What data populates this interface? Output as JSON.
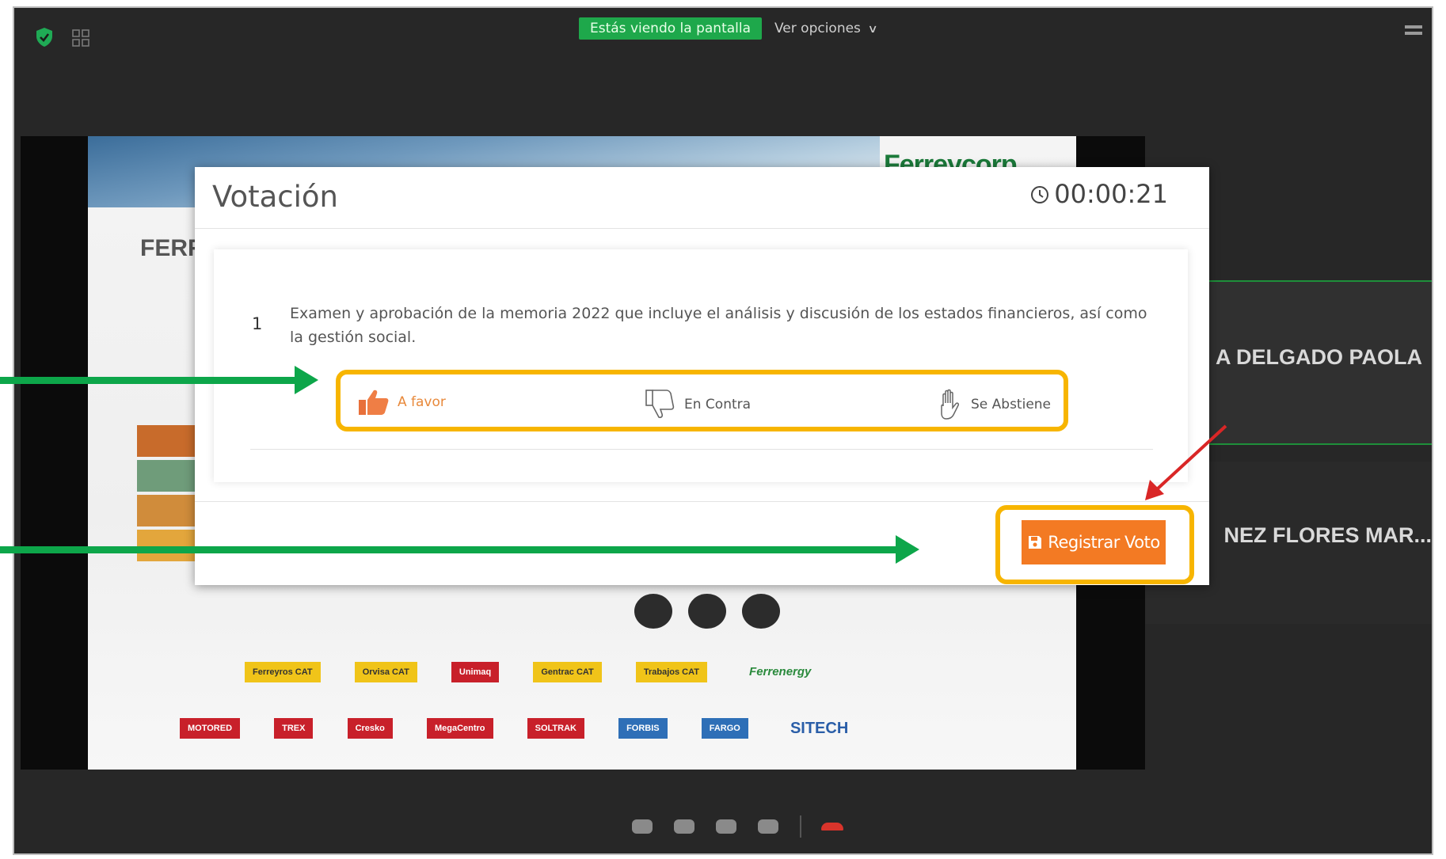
{
  "top_bar": {
    "screen_notice": "Estás viendo la pantalla",
    "view_options": "Ver opciones"
  },
  "slide": {
    "brand": "Ferreycorp",
    "title_fragment": "FERR",
    "logos_row1": [
      "Ferreyros CAT",
      "Orvisa CAT",
      "Unimaq",
      "Gentrac CAT",
      "Trabajos CAT",
      "Ferrenergy"
    ],
    "logos_row2": [
      "MOTORED",
      "TREX",
      "Cresko",
      "MegaCentro",
      "SOLTRAK",
      "FORBIS",
      "FARGO",
      "SITECH"
    ]
  },
  "participants": [
    {
      "name": "A DELGADO PAOLA"
    },
    {
      "name": "NEZ FLORES MAR..."
    }
  ],
  "modal": {
    "title": "Votación",
    "timer": "00:00:21",
    "question": {
      "number": "1",
      "text": "Examen y aprobación de la memoria 2022 que incluye el análisis y discusión de los estados financieros, así como la gestión social."
    },
    "options": {
      "favor": "A favor",
      "contra": "En Contra",
      "abstiene": "Se Abstiene"
    },
    "submit_label": "Registrar Voto"
  },
  "colors": {
    "accent_orange": "#f37a23",
    "highlight_yellow": "#f7b500",
    "arrow_green": "#0da64a",
    "screen_pill_green": "#1ea84b"
  }
}
